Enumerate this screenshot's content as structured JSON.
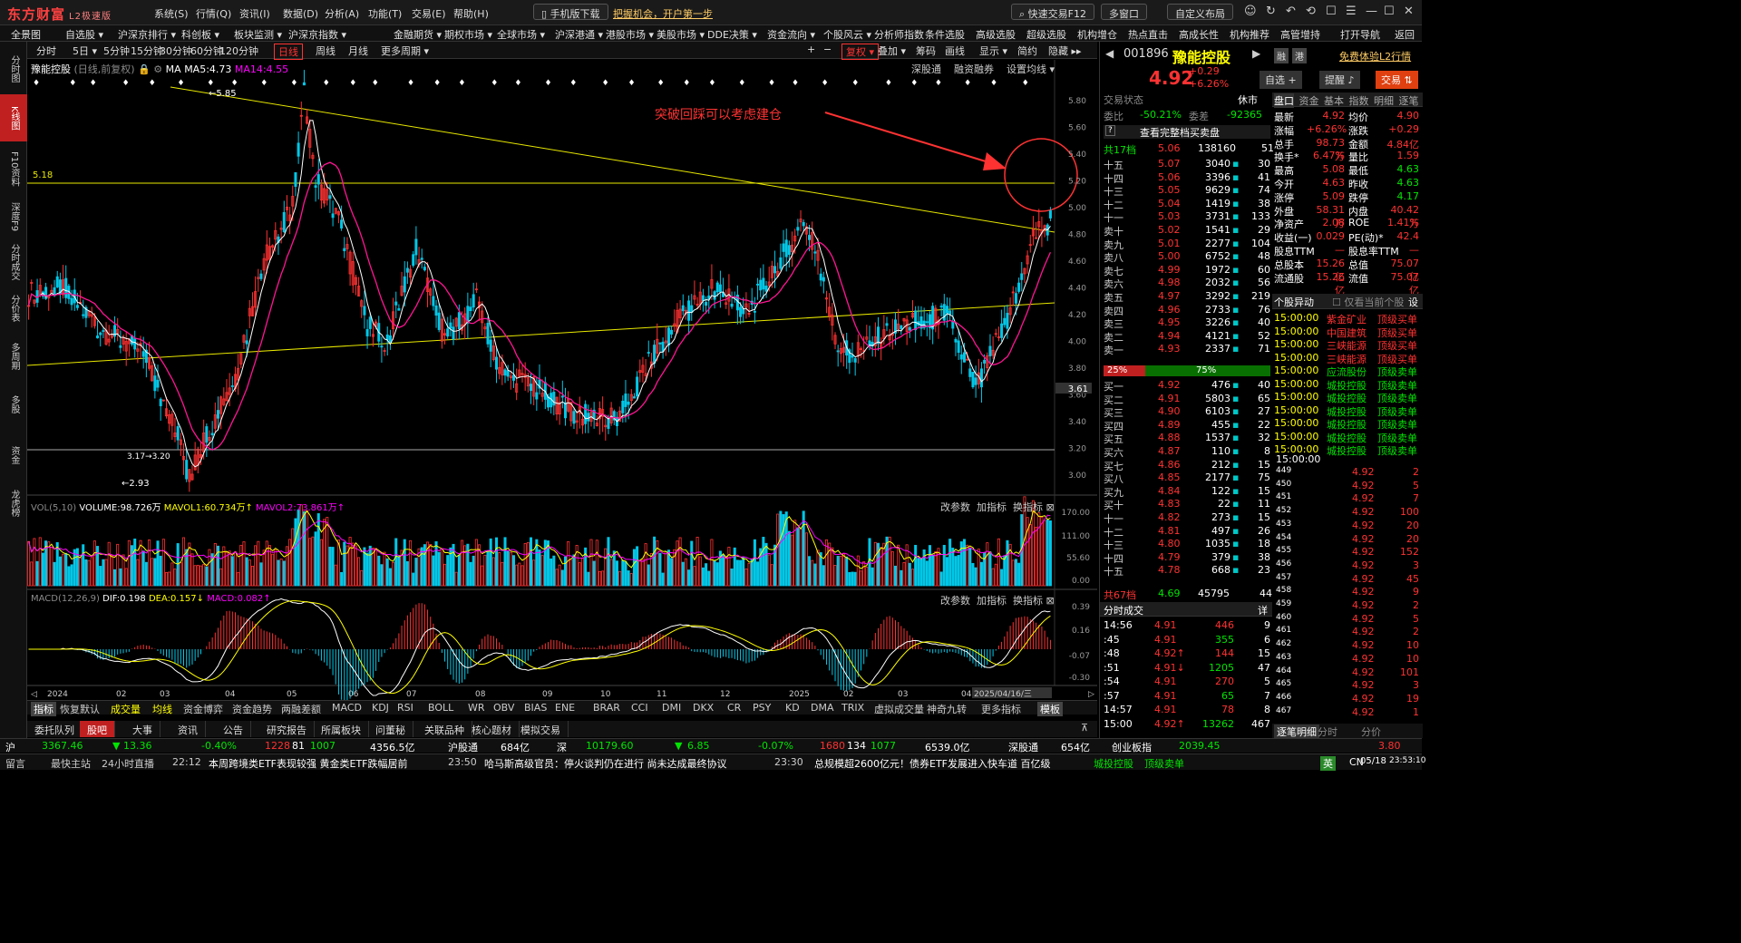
{
  "app": {
    "logo": "东方财富",
    "edition": "L2极速版",
    "menus": [
      "系统(S)",
      "行情(Q)",
      "资讯(I)",
      "数据(D)",
      "分析(A)",
      "功能(T)",
      "交易(E)",
      "帮助(H)"
    ],
    "mobile_btn": "手机版下载",
    "promo": "把握机会，开户第一步",
    "quick_trade": "快速交易F12",
    "multi_window": "多窗口",
    "custom_layout": "自定义布局"
  },
  "nav": [
    "全景图",
    "自选股 ▾",
    "沪深京排行 ▾",
    "科创板 ▾",
    "板块监测 ▾",
    "沪深京指数 ▾",
    "金融期货 ▾",
    "期权市场 ▾",
    "全球市场 ▾",
    "沪深港通 ▾",
    "港股市场 ▾",
    "美股市场 ▾",
    "DDE决策 ▾",
    "资金流向 ▾",
    "个股风云 ▾",
    "分析师指数",
    "条件选股",
    "高级选股",
    "超级选股",
    "机构增仓",
    "热点直击",
    "高成长性",
    "机构推荐",
    "高管增持",
    "打开导航",
    "返回"
  ],
  "sidebar": [
    "分时图",
    "K线图",
    "F10资料",
    "深度F9",
    "分时成交",
    "分价表",
    "多周期",
    "多股",
    "资金",
    "龙虎榜"
  ],
  "periods": [
    "分时",
    "5日 ▾",
    "5分钟",
    "15分钟",
    "30分钟",
    "60分钟",
    "120分钟",
    "日线",
    "周线",
    "月线",
    "更多周期 ▾"
  ],
  "toolbar_right": [
    "复权 ▾",
    "叠加 ▾",
    "筹码",
    "画线",
    "显示 ▾",
    "简约",
    "隐藏 ▸▸"
  ],
  "chart_header": {
    "name": "豫能控股",
    "mode": "(日线,前复权)",
    "ma_label": "MA",
    "ma5": "MA5:4.73",
    "ma14": "MA14:4.55",
    "links": [
      "深股通",
      "融资融券",
      "设置均线 ▾"
    ]
  },
  "annotation": "突破回踩可以考虑建仓",
  "hline_label": "5.18",
  "price_marker": "3.61",
  "high_label": "←5.85",
  "low_label": "←2.93",
  "range_label": "3.17→3.20",
  "price_axis": [
    "5.80",
    "5.60",
    "5.40",
    "5.20",
    "5.00",
    "4.80",
    "4.60",
    "4.40",
    "4.20",
    "4.00",
    "3.80",
    "3.60",
    "3.40",
    "3.20",
    "3.00"
  ],
  "vol_header": {
    "name": "VOL(5,10)",
    "volume": "VOLUME:98.726万",
    "mavol1": "MAVOL1:60.734万",
    "mavol2": "MAVOL2:73.861万"
  },
  "vol_axis": [
    "170.00",
    "111.00",
    "55.60",
    "0.00"
  ],
  "macd_header": {
    "name": "MACD(12,26,9)",
    "dif": "DIF:0.198",
    "dea": "DEA:0.157",
    "macd": "MACD:0.082"
  },
  "macd_axis": [
    "0.39",
    "0.16",
    "-0.07",
    "-0.30"
  ],
  "panel_links": [
    "改参数",
    "加指标",
    "换指标"
  ],
  "date_axis": [
    "2024",
    "02",
    "03",
    "04",
    "05",
    "06",
    "07",
    "08",
    "09",
    "10",
    "11",
    "12",
    "2025",
    "02",
    "03",
    "04",
    "2025/04/16/三"
  ],
  "indicator_tabs": [
    "指标",
    "恢复默认",
    "成交量",
    "均线",
    "资金博弈",
    "资金趋势",
    "两融差额",
    "MACD",
    "KDJ",
    "RSI",
    "BOLL",
    "WR",
    "OBV",
    "BIAS",
    "ENE",
    "BRAR",
    "CCI",
    "DMI",
    "DKX",
    "CR",
    "PSY",
    "KD",
    "DMA",
    "TRIX",
    "虚拟成交量",
    "神奇九转",
    "更多指标",
    "模板"
  ],
  "bottom_tabs": [
    "委托队列",
    "股吧",
    "大事",
    "资讯",
    "公告",
    "研究报告",
    "所属板块",
    "问董秘",
    "关联品种",
    "核心题材",
    "模拟交易"
  ],
  "stock": {
    "code": "001896",
    "name": "豫能控股",
    "price": "4.92",
    "change": "+0.29",
    "pct": "+6.26%",
    "badges": [
      "融",
      "港"
    ],
    "trial": "免费体验L2行情",
    "watch": "自选 +",
    "alert": "提醒",
    "trade": "交易"
  },
  "trade_state": {
    "label": "交易状态",
    "value": "休市"
  },
  "ratio": {
    "wb_label": "委比",
    "wb": "-50.21%",
    "wc_label": "委差",
    "wc": "-92365",
    "full": "查看完整档买卖盘"
  },
  "sell_total": {
    "label": "共17档",
    "price": "5.06",
    "vol": "138160",
    "count": "51"
  },
  "buy_total": {
    "label": "共67档",
    "price": "4.69",
    "vol": "45795",
    "count": "44"
  },
  "sells": [
    [
      "十五",
      "5.07",
      "3040",
      "30"
    ],
    [
      "十四",
      "5.06",
      "3396",
      "41"
    ],
    [
      "十三",
      "5.05",
      "9629",
      "74"
    ],
    [
      "十二",
      "5.04",
      "1419",
      "38"
    ],
    [
      "十一",
      "5.03",
      "3731",
      "133"
    ],
    [
      "卖十",
      "5.02",
      "1541",
      "29"
    ],
    [
      "卖九",
      "5.01",
      "2277",
      "104"
    ],
    [
      "卖八",
      "5.00",
      "6752",
      "48"
    ],
    [
      "卖七",
      "4.99",
      "1972",
      "60"
    ],
    [
      "卖六",
      "4.98",
      "2032",
      "56"
    ],
    [
      "卖五",
      "4.97",
      "3292",
      "219"
    ],
    [
      "卖四",
      "4.96",
      "2733",
      "76"
    ],
    [
      "卖三",
      "4.95",
      "3226",
      "40"
    ],
    [
      "卖二",
      "4.94",
      "4121",
      "52"
    ],
    [
      "卖一",
      "4.93",
      "2337",
      "71"
    ]
  ],
  "bid_ask_bar": {
    "left": "25%",
    "right": "75%"
  },
  "buys": [
    [
      "买一",
      "4.92",
      "476",
      "40"
    ],
    [
      "买二",
      "4.91",
      "5803",
      "65"
    ],
    [
      "买三",
      "4.90",
      "6103",
      "27"
    ],
    [
      "买四",
      "4.89",
      "455",
      "22"
    ],
    [
      "买五",
      "4.88",
      "1537",
      "32"
    ],
    [
      "买六",
      "4.87",
      "110",
      "8"
    ],
    [
      "买七",
      "4.86",
      "212",
      "15"
    ],
    [
      "买八",
      "4.85",
      "2177",
      "75"
    ],
    [
      "买九",
      "4.84",
      "122",
      "15"
    ],
    [
      "买十",
      "4.83",
      "22",
      "11"
    ],
    [
      "十一",
      "4.82",
      "273",
      "15"
    ],
    [
      "十二",
      "4.81",
      "497",
      "26"
    ],
    [
      "十三",
      "4.80",
      "1035",
      "18"
    ],
    [
      "十四",
      "4.79",
      "379",
      "38"
    ],
    [
      "十五",
      "4.78",
      "668",
      "23"
    ]
  ],
  "panel_tabs": [
    "盘口",
    "资金",
    "基本",
    "指数",
    "明细",
    "逐笔"
  ],
  "quote": [
    [
      "最新",
      "4.92",
      "均价",
      "4.90"
    ],
    [
      "涨幅",
      "+6.26%",
      "涨跌",
      "+0.29"
    ],
    [
      "总手",
      "98.73万",
      "金额",
      "4.84亿"
    ],
    [
      "换手*",
      "6.47%",
      "量比",
      "1.59"
    ],
    [
      "最高",
      "5.08",
      "最低",
      "4.63"
    ],
    [
      "今开",
      "4.63",
      "昨收",
      "4.63"
    ],
    [
      "涨停",
      "5.09",
      "跌停",
      "4.17"
    ],
    [
      "外盘",
      "58.31万",
      "内盘",
      "40.42万"
    ],
    [
      "净资产",
      "2.08",
      "ROE",
      "1.41%"
    ],
    [
      "收益(一)",
      "0.029",
      "PE(动)*",
      "42.4"
    ],
    [
      "股息TTM",
      "—",
      "股息率TTM",
      "—"
    ],
    [
      "总股本",
      "15.26亿",
      "总值",
      "75.07亿"
    ],
    [
      "流通股",
      "15.26亿",
      "流值",
      "75.07亿"
    ]
  ],
  "moves": {
    "title": "个股异动",
    "filter": "仅看当前个股",
    "items": [
      [
        "15:00:00",
        "紫金矿业",
        "顶级买单"
      ],
      [
        "15:00:00",
        "中国建筑",
        "顶级买单"
      ],
      [
        "15:00:00",
        "三峡能源",
        "顶级买单"
      ],
      [
        "15:00:00",
        "三峡能源",
        "顶级买单"
      ],
      [
        "15:00:00",
        "应流股份",
        "顶级卖单"
      ],
      [
        "15:00:00",
        "城投控股",
        "顶级卖单"
      ],
      [
        "15:00:00",
        "城投控股",
        "顶级卖单"
      ],
      [
        "15:00:00",
        "城投控股",
        "顶级卖单"
      ],
      [
        "15:00:00",
        "城投控股",
        "顶级卖单"
      ],
      [
        "15:00:00",
        "城投控股",
        "顶级卖单"
      ],
      [
        "15:00:00",
        "城投控股",
        "顶级卖单"
      ]
    ]
  },
  "ticks_title": "分时成交",
  "ticks_more": "详",
  "ticks": [
    [
      "14:56",
      "4.91",
      "446",
      "9"
    ],
    [
      ":45",
      "4.91",
      "355",
      "6"
    ],
    [
      ":48",
      "4.92↑",
      "144",
      "15"
    ],
    [
      ":51",
      "4.91↓",
      "1205",
      "47"
    ],
    [
      ":54",
      "4.91",
      "270",
      "5"
    ],
    [
      ":57",
      "4.91",
      "65",
      "7"
    ],
    [
      "14:57",
      "4.91",
      "78",
      "8"
    ],
    [
      "15:00",
      "4.92↑",
      "13262",
      "467"
    ]
  ],
  "detail_head": "15:00:00",
  "details": [
    [
      "449",
      "4.92",
      "2"
    ],
    [
      "450",
      "4.92",
      "5"
    ],
    [
      "451",
      "4.92",
      "7"
    ],
    [
      "452",
      "4.92",
      "100"
    ],
    [
      "453",
      "4.92",
      "20"
    ],
    [
      "454",
      "4.92",
      "20"
    ],
    [
      "455",
      "4.92",
      "152"
    ],
    [
      "456",
      "4.92",
      "3"
    ],
    [
      "457",
      "4.92",
      "45"
    ],
    [
      "458",
      "4.92",
      "9"
    ],
    [
      "459",
      "4.92",
      "2"
    ],
    [
      "460",
      "4.92",
      "5"
    ],
    [
      "461",
      "4.92",
      "2"
    ],
    [
      "462",
      "4.92",
      "10"
    ],
    [
      "463",
      "4.92",
      "10"
    ],
    [
      "464",
      "4.92",
      "101"
    ],
    [
      "465",
      "4.92",
      "3"
    ],
    [
      "466",
      "4.92",
      "19"
    ],
    [
      "467",
      "4.92",
      "1"
    ]
  ],
  "right_bottom_tabs": [
    "逐笔明细",
    "分时",
    "分价"
  ],
  "status1": {
    "sh": "沪",
    "sh_val": "3367.46",
    "sh_chg": "13.36",
    "sh_pct": "-0.40%",
    "sh_amt": "1228",
    "sh_up": "81",
    "sh_dn": "1007",
    "sh_vol": "4356.5亿",
    "hgt": "沪股通",
    "hgt_val": "684亿",
    "sz": "深",
    "sz_val": "10179.60",
    "sz_chg": "6.85",
    "sz_pct": "-0.07%",
    "sz_amt": "1680",
    "sz_up": "134",
    "sz_dn": "1077",
    "sz_vol": "6539.0亿",
    "sgt": "深股通",
    "sgt_val": "654亿",
    "cyb": "创业板指",
    "cyb_val": "2039.45",
    "right_val": "3.80"
  },
  "status2": {
    "items": [
      "留言",
      "最快主站",
      "24小时直播",
      "22:12",
      "本周跨境类ETF表现较强 黄金类ETF跌幅居前",
      "23:50",
      "哈马斯高级官员：停火谈判仍在进行 尚未达成最终协议",
      "23:30",
      "总规模超2600亿元！债券ETF发展进入快车道 百亿级",
      "城投控股",
      "顶级卖单"
    ],
    "ime": "英",
    "region": "CN",
    "date": "05/18",
    "time": "23:53:10"
  }
}
